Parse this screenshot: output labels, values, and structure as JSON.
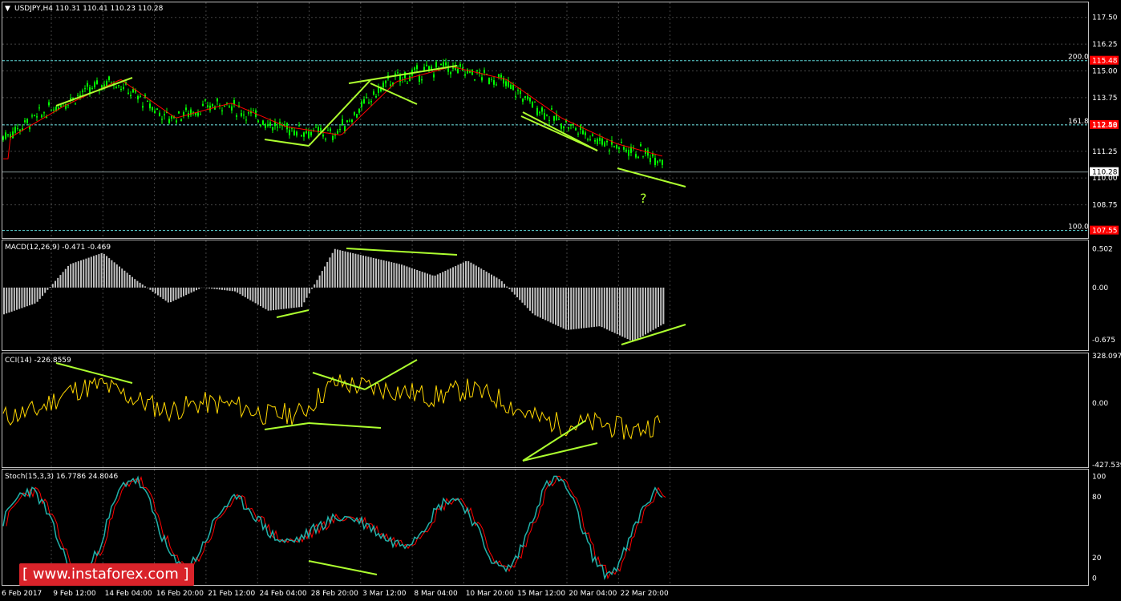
{
  "window": {
    "symbol_line": "USDJPY,H4  110.31 110.41 110.23 110.28",
    "watermark": "[ www.instaforex.com ]",
    "question_mark": "?"
  },
  "panels": {
    "price": {
      "ticks": [
        "117.50",
        "116.25",
        "115.00",
        "113.75",
        "112.50",
        "111.25",
        "110.00",
        "108.75"
      ],
      "current_price": "110.28",
      "fib_levels": [
        {
          "label": "200.0",
          "price": "115.48",
          "color": "#5fd7d7"
        },
        {
          "label": "161.8",
          "price": "112.48",
          "color": "#5fd7d7"
        },
        {
          "label": "100.0",
          "price": "107.55",
          "color": "#5fd7d7"
        }
      ]
    },
    "macd": {
      "title": "MACD(12,26,9) -0.471 -0.469",
      "ticks": [
        "0.502",
        "0.00",
        "-0.675"
      ]
    },
    "cci": {
      "title": "CCI(14) -226.8559",
      "ticks": [
        "328.0971",
        "0.00",
        "-427.539"
      ]
    },
    "stoch": {
      "title": "Stoch(15,3,3) 16.7786 24.8046",
      "ticks": [
        "100",
        "80",
        "20",
        "0"
      ]
    }
  },
  "x_axis": [
    "6 Feb 2017",
    "9 Feb 12:00",
    "14 Feb 04:00",
    "16 Feb 20:00",
    "21 Feb 12:00",
    "24 Feb 04:00",
    "28 Feb 20:00",
    "3 Mar 12:00",
    "8 Mar 04:00",
    "10 Mar 20:00",
    "15 Mar 12:00",
    "20 Mar 04:00",
    "22 Mar 20:00"
  ],
  "colors": {
    "background": "#000000",
    "candles": "#00ff00",
    "trendlines": "#adff2f",
    "moving_average": "#ff0000",
    "macd_hist": "#c0c0c0",
    "cci_line": "#ffd700",
    "stoch_main": "#20b2aa",
    "fib": "#5fd7d7",
    "price_tag": "#ff0000"
  },
  "chart_data": {
    "type": "line",
    "title": "USDJPY,H4  110.31 110.41 110.23 110.28",
    "x": [
      "6 Feb 2017",
      "9 Feb 12:00",
      "14 Feb 04:00",
      "16 Feb 20:00",
      "21 Feb 12:00",
      "24 Feb 04:00",
      "28 Feb 20:00",
      "3 Mar 12:00",
      "8 Mar 04:00",
      "10 Mar 20:00",
      "15 Mar 12:00",
      "20 Mar 04:00",
      "22 Mar 20:00"
    ],
    "series": [
      {
        "values": [
          111.9,
          113.4,
          114.6,
          112.8,
          113.5,
          112.4,
          112.0,
          114.5,
          115.2,
          114.6,
          112.8,
          111.6,
          110.9
        ]
      }
    ],
    "ylim": [
      108.0,
      118.2
    ]
  }
}
